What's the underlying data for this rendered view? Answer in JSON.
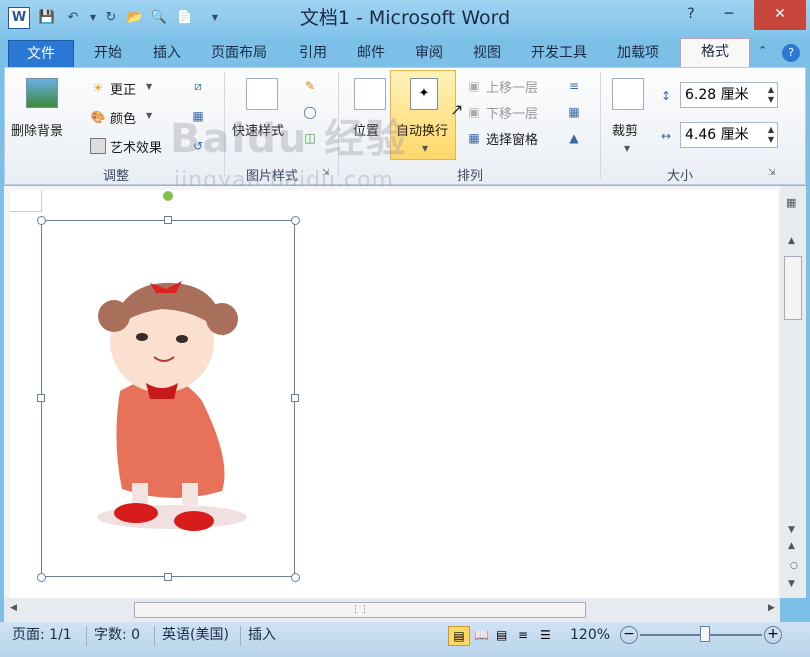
{
  "window": {
    "title": "文档1 - Microsoft Word",
    "logo_letter": "W"
  },
  "tabs": [
    "文件",
    "开始",
    "插入",
    "页面布局",
    "引用",
    "邮件",
    "审阅",
    "视图",
    "开发工具",
    "加载项",
    "格式"
  ],
  "ribbon": {
    "adjust": {
      "remove_bg": "删除背景",
      "corrections": "更正",
      "color": "颜色",
      "artistic": "艺术效果",
      "label": "调整"
    },
    "picture_styles": {
      "quick_styles": "快速样式",
      "label": "图片样式"
    },
    "arrange": {
      "position": "位置",
      "wrap_text": "自动换行",
      "bring_forward": "上移一层",
      "send_backward": "下移一层",
      "selection_pane": "选择窗格",
      "label": "排列"
    },
    "size": {
      "crop": "裁剪",
      "height": "6.28 厘米",
      "width": "4.46 厘米",
      "label": "大小"
    }
  },
  "watermark": {
    "brand": "Baidu 经验",
    "url": "jingyan.baidu.com"
  },
  "statusbar": {
    "page": "页面: 1/1",
    "words": "字数: 0",
    "language": "英语(美国)",
    "mode": "插入",
    "zoom": "120%"
  },
  "colors": {
    "accent": "#2b78d4",
    "highlight": "#ffd86a",
    "close": "#c7453a"
  }
}
